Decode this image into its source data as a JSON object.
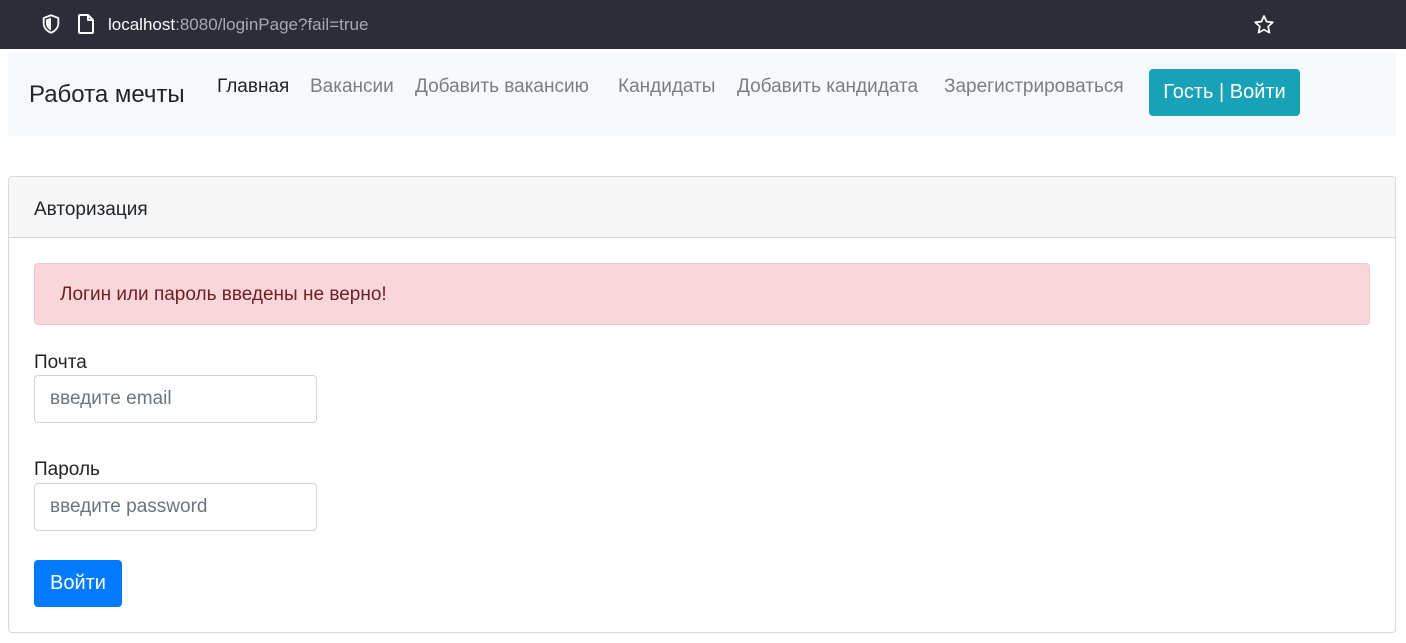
{
  "browser": {
    "url_host": "localhost",
    "url_rest": ":8080/loginPage?fail=true",
    "icons": {
      "shield": "shield-icon",
      "page": "page-icon",
      "bookmark": "star-icon"
    }
  },
  "navbar": {
    "brand": "Работа мечты",
    "links": [
      {
        "label": "Главная",
        "active": true
      },
      {
        "label": "Вакансии",
        "active": false
      },
      {
        "label": "Добавить вакансию",
        "active": false
      },
      {
        "label": "Кандидаты",
        "active": false
      },
      {
        "label": "Добавить кандидата",
        "active": false
      },
      {
        "label": "Зарегистрироваться",
        "active": false
      }
    ],
    "login_button": "Гость | Войти"
  },
  "card": {
    "title": "Авторизация",
    "alert": "Логин или пароль введены не верно!",
    "email_label": "Почта",
    "email_placeholder": "введите email",
    "email_value": "",
    "password_label": "Пароль",
    "password_placeholder": "введите password",
    "password_value": "",
    "submit": "Войти"
  },
  "colors": {
    "browser_bar": "#2b2e38",
    "navbar_bg": "#f8f9fa",
    "login_button": "#17a2b8",
    "submit_button": "#007bff",
    "alert_bg": "#f8d7da",
    "alert_text": "#721c24"
  }
}
